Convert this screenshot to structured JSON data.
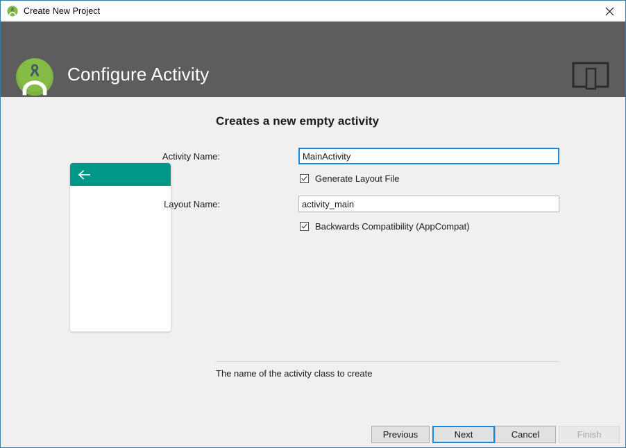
{
  "window": {
    "title": "Create New Project",
    "title_icon": "android-studio-icon",
    "close_label": "×"
  },
  "header": {
    "title": "Configure Activity",
    "logo_icon": "android-studio-logo",
    "device_icon": "tablet-phone-preview-icon"
  },
  "main": {
    "section_title": "Creates a new empty activity",
    "preview": {
      "back_icon": "arrow-left-icon",
      "appbar_color": "#009688",
      "body_color": "#ffffff"
    },
    "fields": {
      "activity_name": {
        "label": "Activity Name:",
        "value": "MainActivity",
        "placeholder": "Activity Name",
        "focused": true
      },
      "layout_name": {
        "label": "Layout Name:",
        "value": "activity_main",
        "placeholder": "Layout Name",
        "focused": false
      }
    },
    "checkboxes": {
      "generate_layout": {
        "label": "Generate Layout File",
        "checked": true
      },
      "backwards_compat": {
        "label": "Backwards Compatibility (AppCompat)",
        "checked": true
      }
    },
    "help_text": "The name of the activity class to create"
  },
  "footer": {
    "previous_label": "Previous",
    "next_label": "Next",
    "cancel_label": "Cancel",
    "finish_label": "Finish"
  },
  "colors": {
    "window_border": "#3a7ca8",
    "header_background": "#5d5d5d",
    "body_background": "#f0f0f0",
    "focus_blue": "#1a87d8",
    "accent_teal": "#009688",
    "logo_green": "#7cb342"
  }
}
